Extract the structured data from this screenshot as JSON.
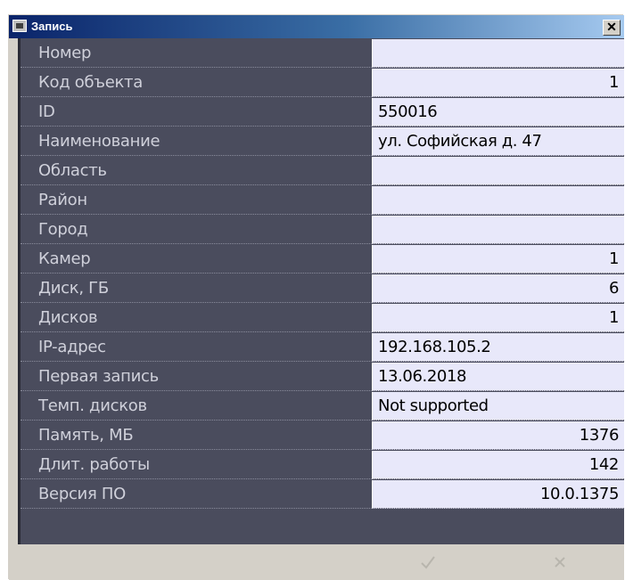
{
  "window": {
    "title": "Запись",
    "close_label": "✕"
  },
  "rows": [
    {
      "name": "Номер",
      "value": "",
      "align": "right"
    },
    {
      "name": "Код объекта",
      "value": "1",
      "align": "right"
    },
    {
      "name": "ID",
      "value": "550016",
      "align": "left"
    },
    {
      "name": "Наименование",
      "value": "ул. Софийская д. 47",
      "align": "left"
    },
    {
      "name": "Область",
      "value": "",
      "align": "left"
    },
    {
      "name": "Район",
      "value": "",
      "align": "left"
    },
    {
      "name": "Город",
      "value": "",
      "align": "left"
    },
    {
      "name": "Камер",
      "value": "1",
      "align": "right"
    },
    {
      "name": "Диск, ГБ",
      "value": "6",
      "align": "right"
    },
    {
      "name": "Дисков",
      "value": "1",
      "align": "right"
    },
    {
      "name": "IP-адрес",
      "value": "192.168.105.2",
      "align": "left"
    },
    {
      "name": "Первая запись",
      "value": "13.06.2018",
      "align": "left"
    },
    {
      "name": "Темп. дисков",
      "value": "Not supported",
      "align": "left"
    },
    {
      "name": "Память, МБ",
      "value": "1376",
      "align": "right"
    },
    {
      "name": "Длит. работы",
      "value": "142",
      "align": "right"
    },
    {
      "name": "Версия ПО",
      "value": "10.0.1375",
      "align": "right"
    }
  ],
  "buttons": {
    "ok_icon": "checkmark-icon",
    "cancel_icon": "cross-icon"
  },
  "colors": {
    "title_bar_start": "#0a246a",
    "label_column": "#4a4c5d",
    "value_column": "#e8e8fa",
    "dialog_face": "#d4d0c8"
  }
}
